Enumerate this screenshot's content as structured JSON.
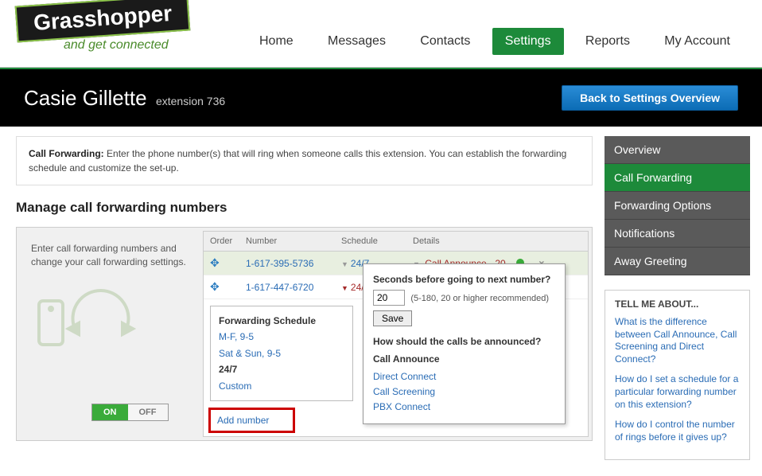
{
  "logo": {
    "main": "Grasshopper",
    "tag": "and get connected"
  },
  "nav": {
    "items": [
      {
        "label": "Home"
      },
      {
        "label": "Messages"
      },
      {
        "label": "Contacts"
      },
      {
        "label": "Settings",
        "active": true
      },
      {
        "label": "Reports"
      },
      {
        "label": "My Account"
      }
    ]
  },
  "titlebar": {
    "name": "Casie Gillette",
    "ext": "extension 736",
    "back": "Back to Settings Overview"
  },
  "info": {
    "label": "Call Forwarding:",
    "text": "Enter the phone number(s) that will ring when someone calls this extension. You can establish the forwarding schedule and customize the set-up."
  },
  "section": "Manage call forwarding numbers",
  "panel": {
    "desc": "Enter call forwarding numbers and change your call forwarding settings.",
    "toggle": {
      "on": "ON",
      "off": "OFF"
    },
    "headers": {
      "order": "Order",
      "number": "Number",
      "schedule": "Schedule",
      "details": "Details"
    },
    "rows": [
      {
        "number": "1-617-395-5736",
        "schedule": "24/7",
        "details": "Call Announce - 20",
        "dot": true
      },
      {
        "number": "1-617-447-6720",
        "schedule": "24/7"
      }
    ],
    "schedule_box": {
      "title": "Forwarding Schedule",
      "opts": [
        "M-F, 9-5",
        "Sat & Sun, 9-5"
      ],
      "bold": "24/7",
      "custom": "Custom"
    },
    "add_number": "Add number"
  },
  "popover": {
    "q1": "Seconds before going to next number?",
    "value": "20",
    "hint": "(5-180, 20 or higher recommended)",
    "save": "Save",
    "q2": "How should the calls be announced?",
    "sub_title": "Call Announce",
    "links": [
      "Direct Connect",
      "Call Screening",
      "PBX Connect"
    ]
  },
  "sidebar": {
    "items": [
      {
        "label": "Overview"
      },
      {
        "label": "Call Forwarding",
        "active": true
      },
      {
        "label": "Forwarding Options"
      },
      {
        "label": "Notifications"
      },
      {
        "label": "Away Greeting"
      }
    ]
  },
  "tell_me": {
    "title": "TELL ME ABOUT...",
    "links": [
      "What is the difference between Call Announce, Call Screening and Direct Connect?",
      "How do I set a schedule for a particular forwarding number on this extension?",
      "How do I control the number of rings before it gives up?"
    ]
  }
}
